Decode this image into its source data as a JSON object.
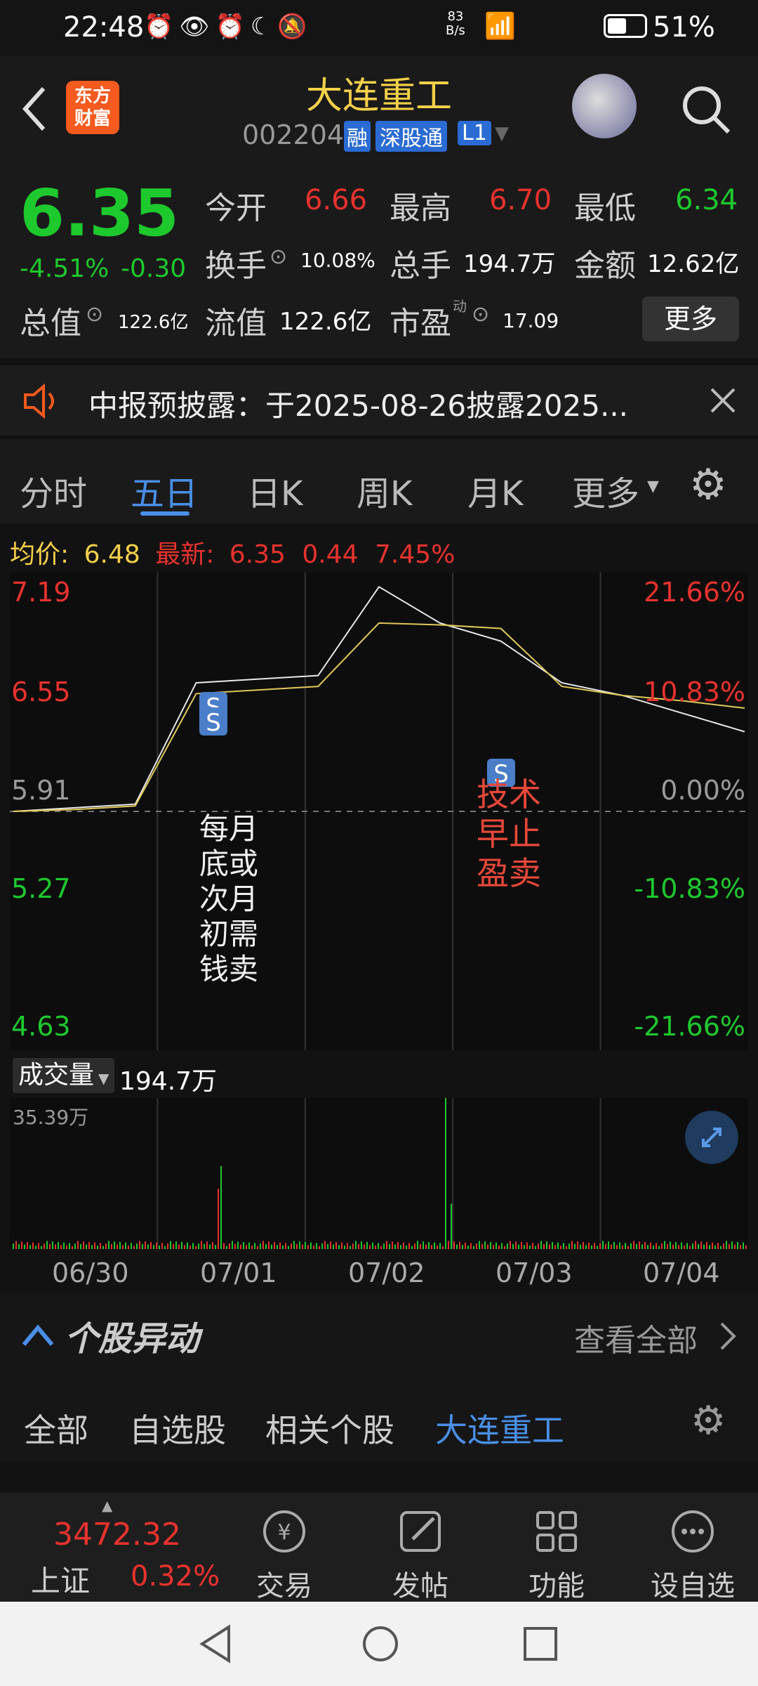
{
  "status": {
    "time": "22:48",
    "net_speed": "83\nB/s",
    "battery": "51%"
  },
  "header": {
    "title": "大连重工",
    "code": "002204",
    "badges": [
      "融",
      "深股通",
      "L1"
    ],
    "logo_text": "东方\n财富"
  },
  "quote": {
    "price": "6.35",
    "change_pct": "-4.51%",
    "change": "-0.30",
    "open_label": "今开",
    "open": "6.66",
    "high_label": "最高",
    "high": "6.70",
    "low_label": "最低",
    "low": "6.34",
    "turnover_label": "换手",
    "turnover": "10.08%",
    "volume_label": "总手",
    "volume": "194.7万",
    "amount_label": "金额",
    "amount": "12.62亿",
    "mktcap_label": "总值",
    "mktcap": "122.6亿",
    "float_label": "流值",
    "float": "122.6亿",
    "pe_label": "市盈",
    "pe_sup": "动",
    "pe": "17.09",
    "more_label": "更多"
  },
  "notice": {
    "text": "中报预披露：于2025-08-26披露2025..."
  },
  "tabs": {
    "items": [
      "分时",
      "五日",
      "日K",
      "周K",
      "月K",
      "更多"
    ],
    "active": "五日"
  },
  "info": {
    "avg_label": "均价:",
    "avg": "6.48",
    "latest_label": "最新:",
    "latest": "6.35",
    "diff": "0.44",
    "pct": "7.45%"
  },
  "chart_data": {
    "type": "line",
    "x": [
      "06/30",
      "07/01",
      "07/02",
      "07/03",
      "07/04"
    ],
    "y_left": [
      "7.19",
      "6.55",
      "5.91",
      "5.27",
      "4.63"
    ],
    "y_right": [
      "21.66%",
      "10.83%",
      "0.00%",
      "-10.83%",
      "-21.66%"
    ],
    "ylim": [
      4.63,
      7.19
    ],
    "prev_close": 5.91,
    "series": [
      {
        "values": [
          5.91,
          5.93,
          5.95,
          6.62,
          6.64,
          6.66,
          7.15,
          6.95,
          6.85,
          6.62,
          6.55,
          6.45,
          6.35
        ]
      },
      {
        "values": [
          5.91,
          5.92,
          5.94,
          6.56,
          6.58,
          6.6,
          6.95,
          6.94,
          6.92,
          6.6,
          6.55,
          6.52,
          6.48
        ]
      }
    ],
    "markers": [
      "S",
      "S",
      "S"
    ]
  },
  "annotations": {
    "left": "每月\n底或\n次月\n初需\n钱卖",
    "right": "技术\n早止\n盈卖"
  },
  "volume": {
    "label": "成交量",
    "value": "194.7万",
    "max": "35.39万"
  },
  "section": {
    "title": "个股异动",
    "link": "查看全部"
  },
  "filters": {
    "items": [
      "全部",
      "自选股",
      "相关个股",
      "大连重工"
    ]
  },
  "bottom": {
    "index_value": "3472.32",
    "index_name": "上证",
    "index_pct": "0.32%",
    "items": [
      {
        "label": "交易"
      },
      {
        "label": "发帖"
      },
      {
        "label": "功能"
      },
      {
        "label": "设自选"
      }
    ]
  },
  "icons": [
    "alarm-icon",
    "eye-icon",
    "moon-icon",
    "mute-icon",
    "wifi-icon",
    "signal-icon",
    "battery-icon",
    "back-icon",
    "search-icon",
    "speaker-icon",
    "close-icon",
    "gear-icon",
    "expand-icon",
    "trade-icon",
    "edit-icon",
    "grid-icon",
    "dots-icon"
  ]
}
